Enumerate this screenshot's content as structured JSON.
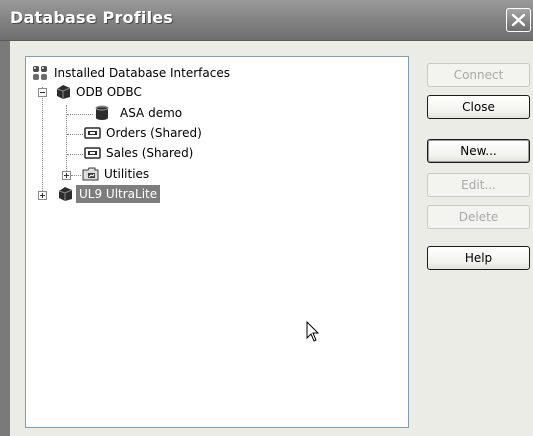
{
  "window": {
    "title": "Database Profiles",
    "close_icon": "close-x-icon"
  },
  "tree": {
    "items": [
      {
        "label": "Installed Database Interfaces",
        "icon": "interfaces-icon",
        "expanded": true
      },
      {
        "label": "ODB ODBC",
        "icon": "database-icon",
        "expanded": true
      },
      {
        "label": "ASA demo",
        "icon": "db-cylinder-icon"
      },
      {
        "label": "Orders (Shared)",
        "icon": "shared-profile-icon"
      },
      {
        "label": "Sales (Shared)",
        "icon": "shared-profile-icon"
      },
      {
        "label": "Utilities",
        "icon": "utilities-icon",
        "expanded": false
      },
      {
        "label": "UL9 UltraLite",
        "icon": "database-icon",
        "expanded": false,
        "selected": true
      }
    ]
  },
  "buttons": {
    "connect": {
      "label": "Connect",
      "enabled": false
    },
    "close": {
      "label": "Close",
      "enabled": true
    },
    "new": {
      "label": "New...",
      "enabled": true
    },
    "edit": {
      "label": "Edit...",
      "enabled": false
    },
    "delete": {
      "label": "Delete",
      "enabled": false
    },
    "help": {
      "label": "Help",
      "enabled": true
    }
  },
  "colors": {
    "titlebar": "#858585",
    "selection": "#7d7d7d",
    "dialog_bg": "#ecece6",
    "tree_border": "#7f9db9"
  }
}
